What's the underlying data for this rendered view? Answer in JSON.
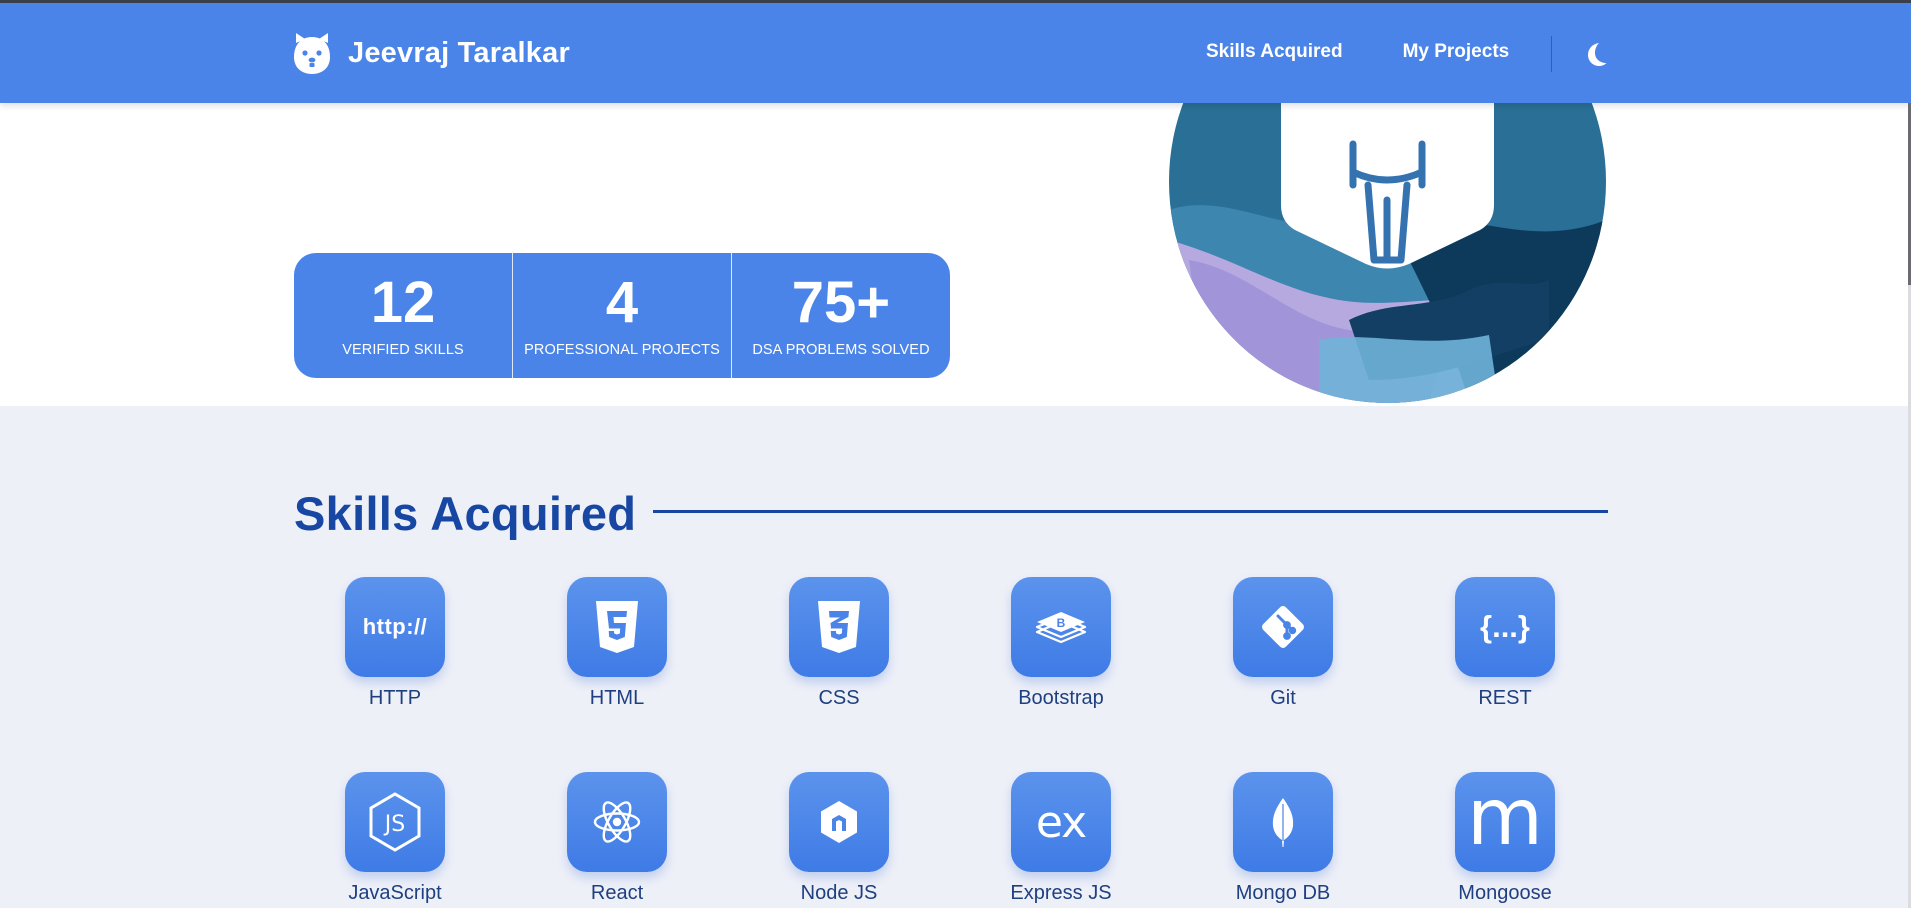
{
  "brand": {
    "name": "Jeevraj Taralkar"
  },
  "nav": {
    "links": [
      "Skills Acquired",
      "My Projects"
    ]
  },
  "stats": [
    {
      "value": "12",
      "label": "VERIFIED SKILLS"
    },
    {
      "value": "4",
      "label": "PROFESSIONAL PROJECTS"
    },
    {
      "value": "75+",
      "label": "DSA PROBLEMS SOLVED"
    }
  ],
  "skills": {
    "title": "Skills Acquired",
    "items": [
      {
        "name": "HTTP",
        "icon": "http-icon",
        "glyph": "http://"
      },
      {
        "name": "HTML",
        "icon": "html5-icon"
      },
      {
        "name": "CSS",
        "icon": "css3-icon"
      },
      {
        "name": "Bootstrap",
        "icon": "bootstrap-icon"
      },
      {
        "name": "Git",
        "icon": "git-icon"
      },
      {
        "name": "REST",
        "icon": "rest-icon",
        "glyph": "{...}"
      },
      {
        "name": "JavaScript",
        "icon": "javascript-icon"
      },
      {
        "name": "React",
        "icon": "react-icon"
      },
      {
        "name": "Node JS",
        "icon": "nodejs-icon"
      },
      {
        "name": "Express JS",
        "icon": "express-icon",
        "glyph": "ex"
      },
      {
        "name": "Mongo DB",
        "icon": "mongodb-icon"
      },
      {
        "name": "Mongoose",
        "icon": "mongoose-icon",
        "glyph": "m"
      }
    ]
  },
  "colors": {
    "primary": "#4a84e8",
    "heading": "#1747a3",
    "section_bg": "#eef0f8"
  },
  "icons": {
    "theme_toggle": "moon-icon",
    "logo": "bear-logo-icon"
  }
}
